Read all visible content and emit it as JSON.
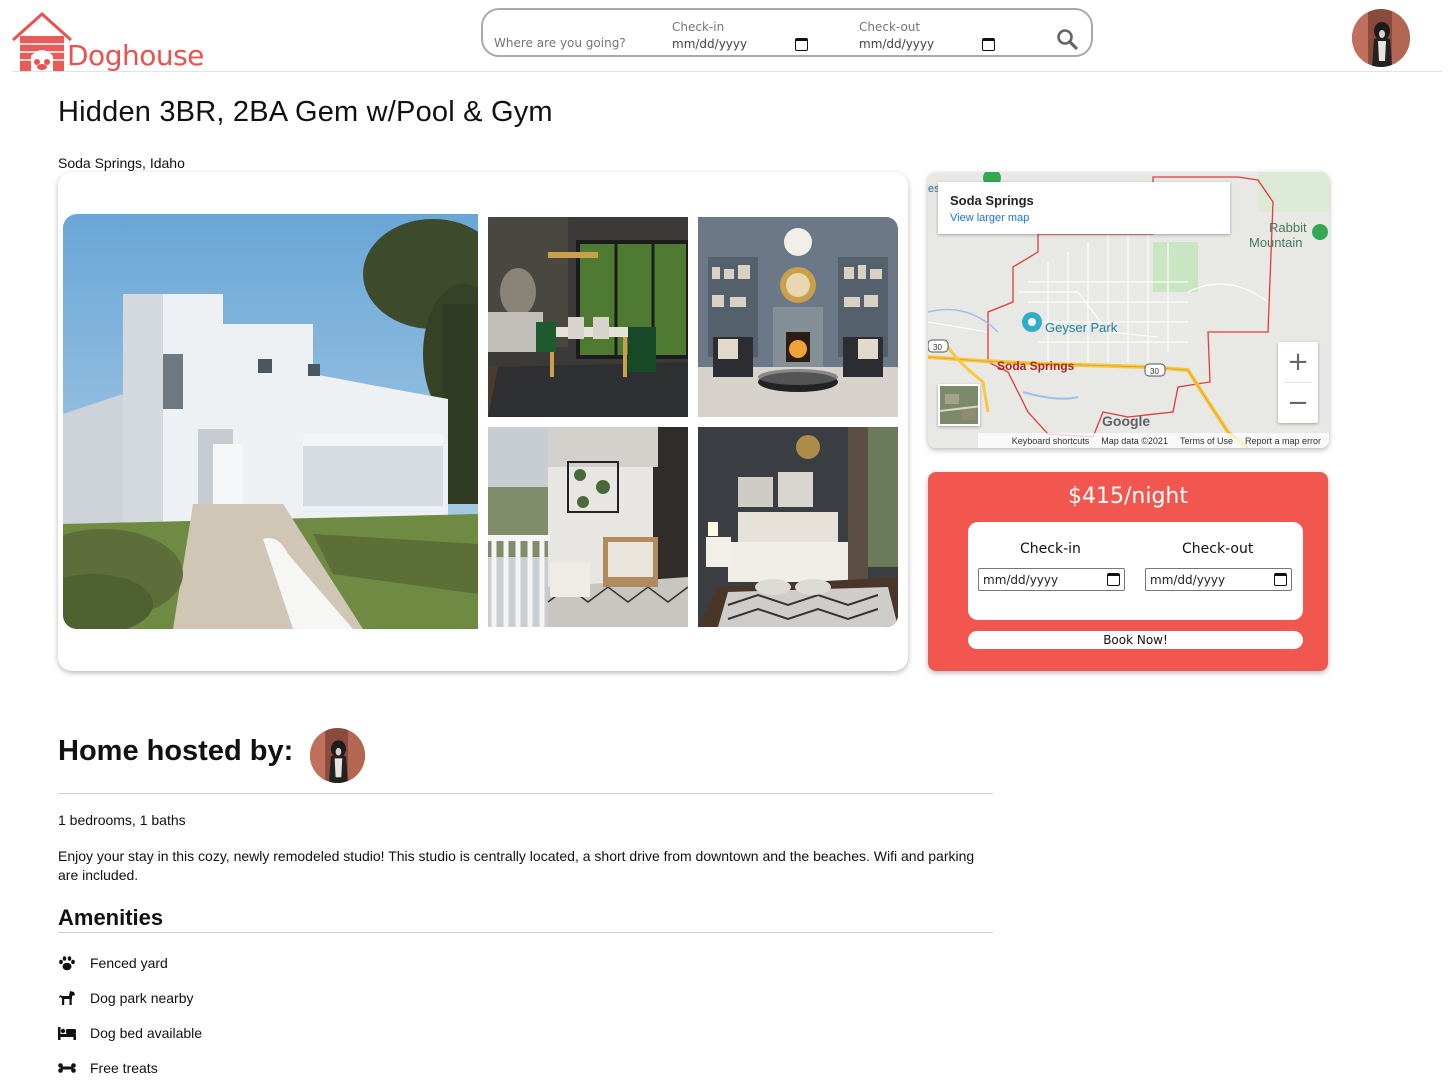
{
  "header": {
    "logo_text": "Doghouse",
    "search": {
      "placeholder": "Where are you going?",
      "checkin_label": "Check-in",
      "checkin_value": "mm/dd/yyyy",
      "checkout_label": "Check-out",
      "checkout_value": "mm/dd/yyyy"
    }
  },
  "listing": {
    "title": "Hidden 3BR, 2BA Gem w/Pool & Gym",
    "location": "Soda Springs, Idaho"
  },
  "map": {
    "place_name": "Soda Springs",
    "view_larger": "View larger map",
    "labels": {
      "rabbit": "Rabbit",
      "mountain": "Mountain",
      "geyser_park": "Geyser Park",
      "town": "Soda Springs",
      "route": "30",
      "edge": "es"
    },
    "zoom_in": "+",
    "zoom_out": "−",
    "google": "Google",
    "footer": {
      "shortcuts": "Keyboard shortcuts",
      "data": "Map data ©2021",
      "terms": "Terms of Use",
      "report": "Report a map error"
    }
  },
  "booking": {
    "price": "$415/night",
    "checkin_label": "Check-in",
    "checkout_label": "Check-out",
    "checkin_value": "mm/dd/yyyy",
    "checkout_value": "mm/dd/yyyy",
    "book_label": "Book Now!"
  },
  "host": {
    "title": "Home hosted by:"
  },
  "details": {
    "rooms": "1 bedrooms, 1 baths",
    "description": "Enjoy your stay in this cozy, newly remodeled studio! This studio is centrally located, a short drive from downtown and the beaches. Wifi and parking are included."
  },
  "amenities": {
    "title": "Amenities",
    "items": [
      {
        "icon": "paw-icon",
        "label": "Fenced yard"
      },
      {
        "icon": "dog-icon",
        "label": "Dog park nearby"
      },
      {
        "icon": "bed-icon",
        "label": "Dog bed available"
      },
      {
        "icon": "bone-icon",
        "label": "Free treats"
      }
    ]
  },
  "colors": {
    "brand": "#e8524f",
    "booking_bg": "#f2574f",
    "map_link": "#1a73e8"
  }
}
